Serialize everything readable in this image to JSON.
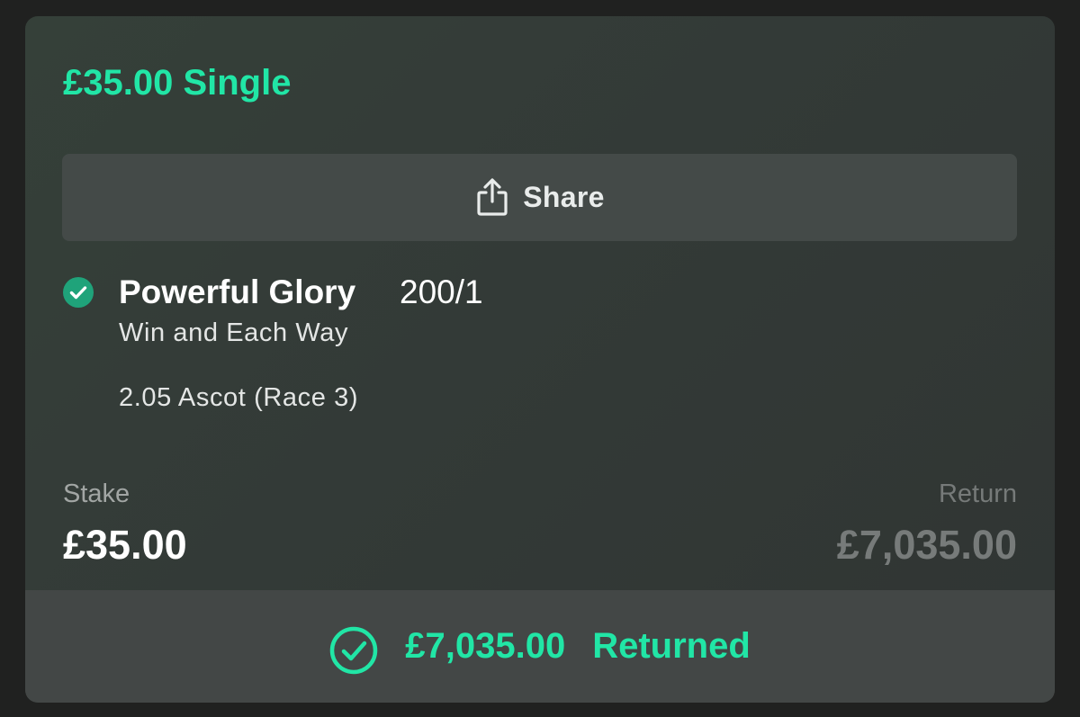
{
  "bet": {
    "title": "£35.00 Single"
  },
  "share": {
    "label": "Share",
    "icon": "share-icon"
  },
  "selection": {
    "status_icon": "check-circle-icon",
    "name": "Powerful Glory",
    "odds": "200/1",
    "market": "Win and Each Way",
    "event": "2.05 Ascot (Race 3)"
  },
  "summary": {
    "stake_label": "Stake",
    "stake_value": "£35.00",
    "return_label": "Return",
    "return_value": "£7,035.00"
  },
  "result": {
    "icon": "check-circle-outline-icon",
    "amount": "£7,035.00",
    "status": "Returned"
  },
  "colors": {
    "accent": "#21e6a6",
    "win_check": "#1fa37a",
    "card_bg": "#333a37",
    "button_bg": "#444a48",
    "footer_bg": "#434746"
  }
}
